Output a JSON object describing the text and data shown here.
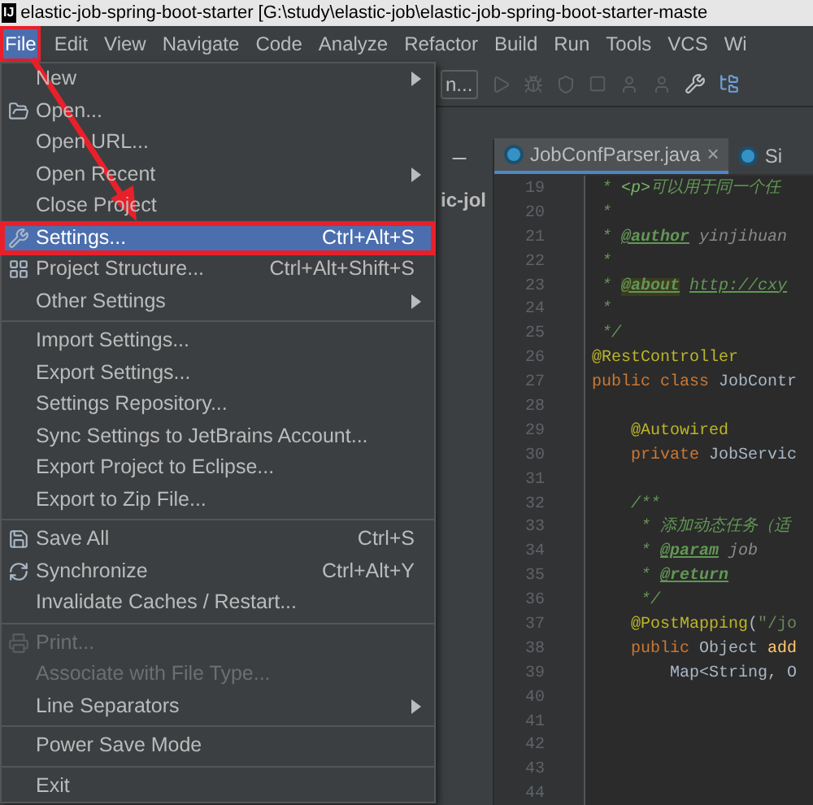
{
  "window": {
    "app_icon": "IJ",
    "title": "elastic-job-spring-boot-starter [G:\\study\\elastic-job\\elastic-job-spring-boot-starter-maste"
  },
  "menubar": [
    {
      "label": "File",
      "selected": true
    },
    {
      "label": "Edit",
      "selected": false
    },
    {
      "label": "View",
      "selected": false
    },
    {
      "label": "Navigate",
      "selected": false
    },
    {
      "label": "Code",
      "selected": false
    },
    {
      "label": "Analyze",
      "selected": false
    },
    {
      "label": "Refactor",
      "selected": false
    },
    {
      "label": "Build",
      "selected": false
    },
    {
      "label": "Run",
      "selected": false
    },
    {
      "label": "Tools",
      "selected": false
    },
    {
      "label": "VCS",
      "selected": false
    },
    {
      "label": "Wi",
      "selected": false
    }
  ],
  "toolbar": {
    "run_config": "n..."
  },
  "project_panel": {
    "item": "ic-jol"
  },
  "editor_tabs": [
    {
      "label": "JobConfParser.java",
      "selected": true,
      "close": "×"
    },
    {
      "label": "Si",
      "selected": false
    }
  ],
  "code_lines": [
    {
      "number": "19",
      "tokens": [
        {
          "text": " * ",
          "kind": "doc"
        },
        {
          "text": "<p>",
          "kind": "doc-html"
        },
        {
          "text": "可以用于同一个任",
          "kind": "doc"
        }
      ]
    },
    {
      "number": "20",
      "tokens": [
        {
          "text": " *",
          "kind": "doc"
        }
      ]
    },
    {
      "number": "21",
      "tokens": [
        {
          "text": " * ",
          "kind": "doc"
        },
        {
          "text": "@author",
          "kind": "doc-tag"
        },
        {
          "text": " yinjihuan",
          "kind": "doc-value"
        }
      ]
    },
    {
      "number": "22",
      "tokens": [
        {
          "text": " *",
          "kind": "doc"
        }
      ]
    },
    {
      "number": "23",
      "tokens": [
        {
          "text": " * ",
          "kind": "doc"
        },
        {
          "text": "@about",
          "kind": "doc-tag-marked"
        },
        {
          "text": "http://cxy",
          "kind": "doc-link"
        }
      ]
    },
    {
      "number": "24",
      "tokens": [
        {
          "text": " *",
          "kind": "doc"
        }
      ]
    },
    {
      "number": "25",
      "tokens": [
        {
          "text": " */",
          "kind": "doc"
        }
      ]
    },
    {
      "number": "26",
      "tokens": [
        {
          "text": "@RestController",
          "kind": "annotation"
        }
      ]
    },
    {
      "number": "27",
      "tokens": [
        {
          "text": "public class ",
          "kind": "keyword"
        },
        {
          "text": "JobContr",
          "kind": "plain"
        }
      ]
    },
    {
      "number": "28"
    },
    {
      "number": "29",
      "tokens": [
        {
          "text": "    @Autowired",
          "kind": "annotation"
        }
      ]
    },
    {
      "number": "30",
      "tokens": [
        {
          "text": "    private ",
          "kind": "keyword"
        },
        {
          "text": "JobServic",
          "kind": "plain"
        }
      ]
    },
    {
      "number": "31"
    },
    {
      "number": "32",
      "tokens": [
        {
          "text": "    /**",
          "kind": "doc"
        }
      ]
    },
    {
      "number": "33",
      "tokens": [
        {
          "text": "     * 添加动态任务（适",
          "kind": "doc"
        }
      ]
    },
    {
      "number": "34",
      "tokens": [
        {
          "text": "     * ",
          "kind": "doc"
        },
        {
          "text": "@param",
          "kind": "doc-tag"
        },
        {
          "text": " job",
          "kind": "doc-value"
        }
      ]
    },
    {
      "number": "35",
      "tokens": [
        {
          "text": "     * ",
          "kind": "doc"
        },
        {
          "text": "@return",
          "kind": "doc-tag"
        }
      ]
    },
    {
      "number": "36",
      "tokens": [
        {
          "text": "     */",
          "kind": "doc"
        }
      ]
    },
    {
      "number": "37",
      "tokens": [
        {
          "text": "    @PostMapping",
          "kind": "annotation"
        },
        {
          "text": "(",
          "kind": "plain"
        },
        {
          "text": "\"/jo",
          "kind": "string"
        }
      ]
    },
    {
      "number": "38",
      "tokens": [
        {
          "text": "    public ",
          "kind": "keyword"
        },
        {
          "text": "Object ",
          "kind": "plain"
        },
        {
          "text": "add",
          "kind": "method"
        }
      ]
    },
    {
      "number": "39",
      "tokens": [
        {
          "text": "        Map<String, O",
          "kind": "plain"
        }
      ]
    },
    {
      "number": "40"
    },
    {
      "number": "41"
    },
    {
      "number": "42"
    },
    {
      "number": "43"
    },
    {
      "number": "44"
    }
  ],
  "file_menu": [
    [
      {
        "label": "New",
        "submenu": true,
        "disabled": false,
        "selected": false
      },
      {
        "label": "Open...",
        "disabled": false,
        "selected": false
      },
      {
        "label": "Open URL...",
        "disabled": false,
        "selected": false
      },
      {
        "label": "Open Recent",
        "submenu": true,
        "disabled": false,
        "selected": false
      },
      {
        "label": "Close Project",
        "disabled": false,
        "selected": false
      },
      {
        "label": "Settings...",
        "shortcut": "Ctrl+Alt+S",
        "disabled": false,
        "selected": true
      },
      {
        "label": "Project Structure...",
        "shortcut": "Ctrl+Alt+Shift+S",
        "disabled": false,
        "selected": false
      },
      {
        "label": "Other Settings",
        "submenu": true,
        "disabled": false,
        "selected": false
      }
    ],
    [
      {
        "label": "Import Settings...",
        "disabled": false,
        "selected": false
      },
      {
        "label": "Export Settings...",
        "disabled": false,
        "selected": false
      },
      {
        "label": "Settings Repository...",
        "disabled": false,
        "selected": false
      },
      {
        "label": "Sync Settings to JetBrains Account...",
        "disabled": false,
        "selected": false
      },
      {
        "label": "Export Project to Eclipse...",
        "disabled": false,
        "selected": false
      },
      {
        "label": "Export to Zip File...",
        "disabled": false,
        "selected": false
      }
    ],
    [
      {
        "label": "Save All",
        "shortcut": "Ctrl+S",
        "disabled": false,
        "selected": false
      },
      {
        "label": "Synchronize",
        "shortcut": "Ctrl+Alt+Y",
        "disabled": false,
        "selected": false
      },
      {
        "label": "Invalidate Caches / Restart...",
        "disabled": false,
        "selected": false
      }
    ],
    [
      {
        "label": "Print...",
        "disabled": true,
        "selected": false
      },
      {
        "label": "Associate with File Type...",
        "disabled": true,
        "selected": false
      },
      {
        "label": "Line Separators",
        "submenu": true,
        "disabled": false,
        "selected": false
      }
    ],
    [
      {
        "label": "Power Save Mode",
        "disabled": false,
        "selected": false
      }
    ],
    [
      {
        "label": "Exit",
        "disabled": false,
        "selected": false
      }
    ]
  ]
}
